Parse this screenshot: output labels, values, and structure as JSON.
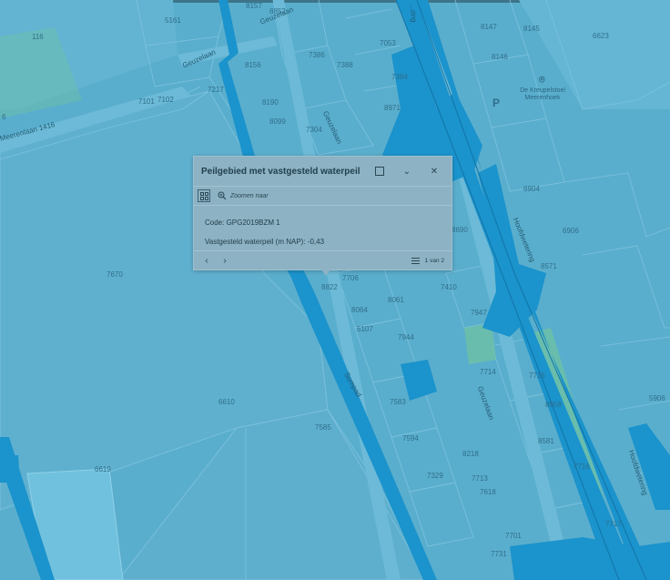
{
  "map": {
    "colors": {
      "background": "#5aaecd",
      "water": "#1b93cc",
      "parcel_line": "#7cc2de",
      "green": "#6ec2a3",
      "road": "#6cbad7"
    },
    "parcel_labels": [
      "5161",
      "8157",
      "8852",
      "7053",
      "8147",
      "8145",
      "6623",
      "8156",
      "7386",
      "7388",
      "7384",
      "8146",
      "7217",
      "8190",
      "7101",
      "7102",
      "8971",
      "8099",
      "7304",
      "7670",
      "6904",
      "6906",
      "8690",
      "8571",
      "7706",
      "7410",
      "8822",
      "8061",
      "8064",
      "7947",
      "5107",
      "7944",
      "7714",
      "7715",
      "8958",
      "7583",
      "5906",
      "6610",
      "7585",
      "7594",
      "8218",
      "8581",
      "7716",
      "6619",
      "7329",
      "7713",
      "7618",
      "7717",
      "7701",
      "7731",
      "116",
      "6"
    ],
    "street_labels": [
      "Geuzelaan",
      "Geuzelaan",
      "Geuzelaan",
      "Geuzelaan",
      "Hoofdwetering",
      "Hoofdwetering",
      "Sompad",
      "Meerenlaan 1416",
      "...ring"
    ],
    "poi_label": "De Kreupelstoel Meerenhoek",
    "poi_icon": "pin-icon",
    "parking_label": "P"
  },
  "popup": {
    "title": "Peilgebied met vastgesteld waterpeil",
    "maximize_icon": "maximize-icon",
    "collapse_icon": "chevron-down-icon",
    "close_icon": "close-icon",
    "zoom_label": "Zoomen naar",
    "fields": [
      "Code: GPG2019BZM 1",
      "Vastgesteld waterpeil (m NAP): -0,43"
    ],
    "pager": "1 van 2"
  }
}
